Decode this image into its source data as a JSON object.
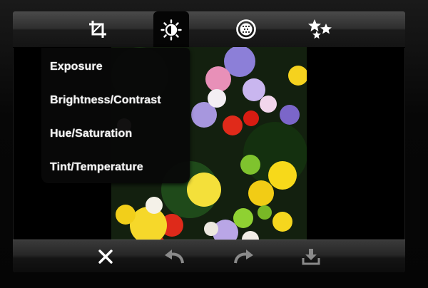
{
  "toolbar_top": {
    "icons": [
      "crop-icon",
      "brightness-icon",
      "filter-icon",
      "effects-stars-icon"
    ],
    "active": "brightness-icon"
  },
  "adjust_menu": {
    "items": [
      {
        "label": "Exposure"
      },
      {
        "label": "Brightness/Contrast"
      },
      {
        "label": "Hue/Saturation"
      },
      {
        "label": "Tint/Temperature"
      }
    ]
  },
  "toolbar_bottom": {
    "icons": [
      "close-icon",
      "undo-icon",
      "redo-icon",
      "save-download-icon"
    ]
  },
  "colors": {
    "toolbar_icon": "#ffffff",
    "disabled_icon": "#8a8a8a",
    "menu_text": "#f2f2f2"
  }
}
